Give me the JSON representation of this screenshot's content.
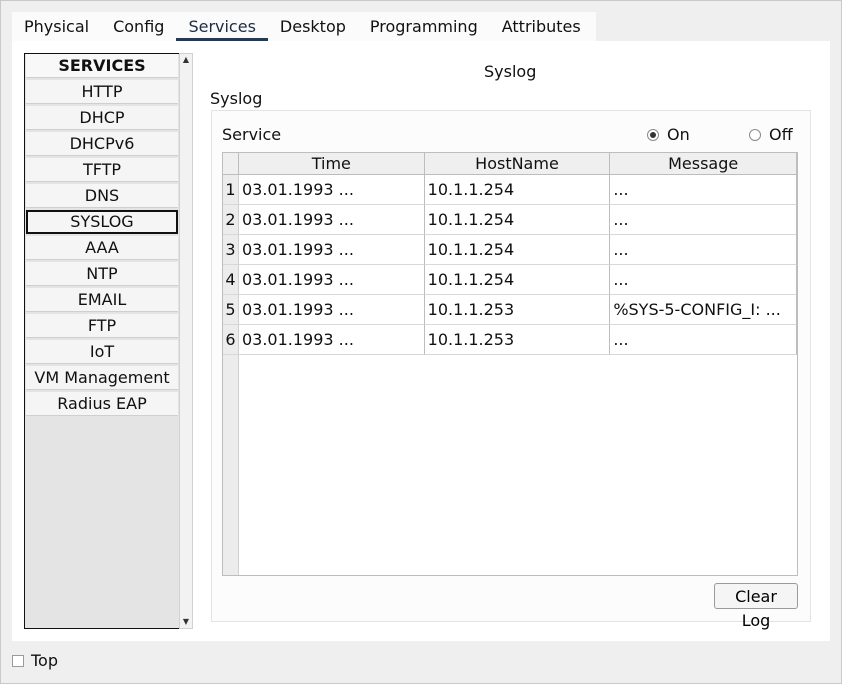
{
  "tabs": [
    {
      "label": "Physical"
    },
    {
      "label": "Config"
    },
    {
      "label": "Services"
    },
    {
      "label": "Desktop"
    },
    {
      "label": "Programming"
    },
    {
      "label": "Attributes"
    }
  ],
  "active_tab": "Services",
  "sidebar": {
    "header": "SERVICES",
    "items": [
      {
        "label": "HTTP"
      },
      {
        "label": "DHCP"
      },
      {
        "label": "DHCPv6"
      },
      {
        "label": "TFTP"
      },
      {
        "label": "DNS"
      },
      {
        "label": "SYSLOG"
      },
      {
        "label": "AAA"
      },
      {
        "label": "NTP"
      },
      {
        "label": "EMAIL"
      },
      {
        "label": "FTP"
      },
      {
        "label": "IoT"
      },
      {
        "label": "VM Management"
      },
      {
        "label": "Radius EAP"
      }
    ],
    "selected": "SYSLOG"
  },
  "content": {
    "title": "Syslog",
    "group_label": "Syslog",
    "service_label": "Service",
    "radio_on": "On",
    "radio_off": "Off",
    "service_state": "On",
    "table": {
      "headers": [
        "Time",
        "HostName",
        "Message"
      ],
      "rows": [
        {
          "num": "1",
          "time": "03.01.1993 ...",
          "host": "10.1.1.254",
          "message": "..."
        },
        {
          "num": "2",
          "time": "03.01.1993 ...",
          "host": "10.1.1.254",
          "message": "..."
        },
        {
          "num": "3",
          "time": "03.01.1993 ...",
          "host": "10.1.1.254",
          "message": "..."
        },
        {
          "num": "4",
          "time": "03.01.1993 ...",
          "host": "10.1.1.254",
          "message": "..."
        },
        {
          "num": "5",
          "time": "03.01.1993 ...",
          "host": "10.1.1.253",
          "message": "%SYS-5-CONFIG_I: ..."
        },
        {
          "num": "6",
          "time": "03.01.1993 ...",
          "host": "10.1.1.253",
          "message": "..."
        }
      ]
    },
    "clear_button": "Clear Log"
  },
  "footer": {
    "top_label": "Top",
    "top_checked": false
  },
  "colors": {
    "active_tab_underline": "#1f3a5a",
    "window_bg": "#efefef",
    "panel_bg": "#ffffff"
  }
}
